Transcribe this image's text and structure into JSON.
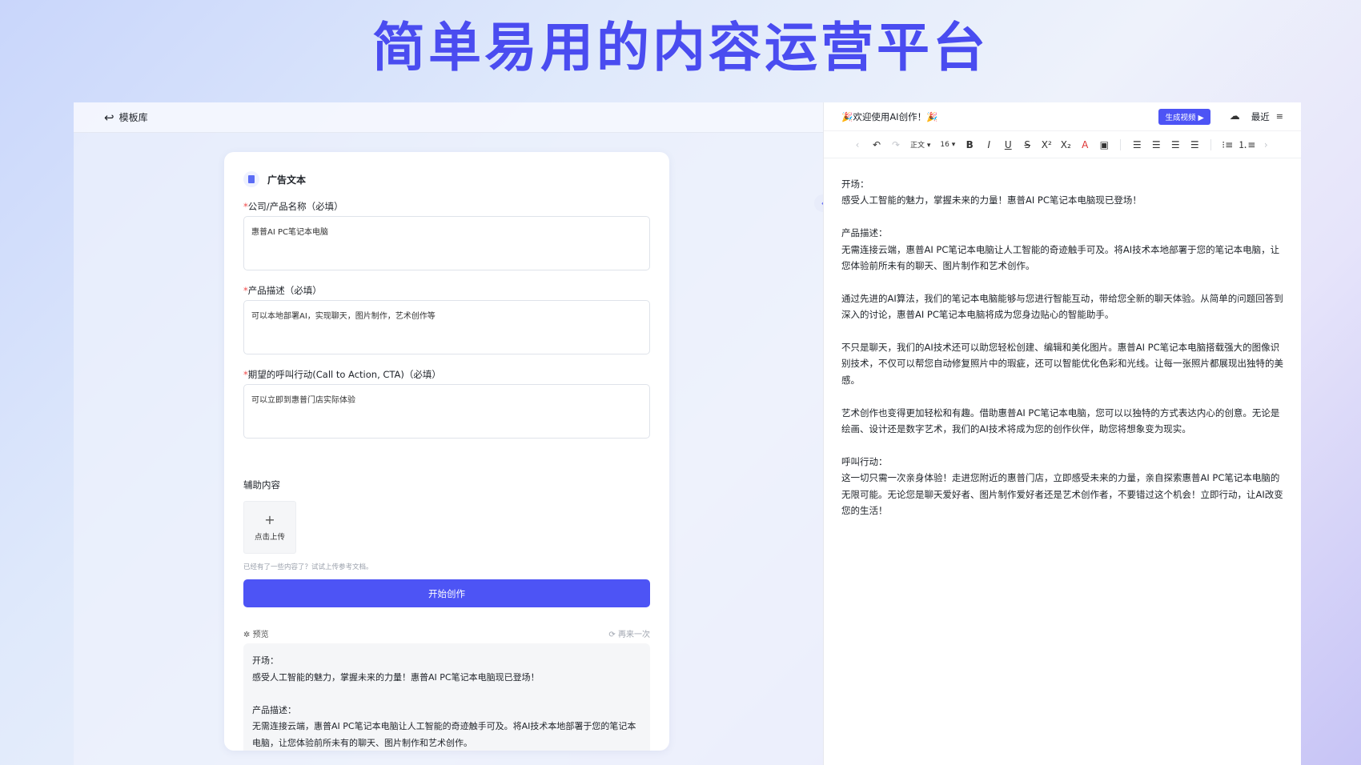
{
  "hero_title": "简单易用的内容运营平台",
  "left": {
    "back_label": "模板库",
    "card_title": "广告文本",
    "fields": [
      {
        "label": "公司/产品名称（必填）",
        "value": "惠普AI PC笔记本电脑"
      },
      {
        "label": "产品描述（必填）",
        "value": "可以本地部署AI，实现聊天，图片制作，艺术创作等"
      },
      {
        "label": "期望的呼叫行动(Call to Action, CTA)（必填）",
        "value": "可以立即到惠普门店实际体验"
      }
    ],
    "aux_label": "辅助内容",
    "upload_label": "点击上传",
    "hint": "已经有了一些内容了？试试上传参考文档。",
    "start_button": "开始创作",
    "preview_label": "预览",
    "again_label": "再来一次",
    "preview_lines": [
      "开场：",
      "感受人工智能的魅力，掌握未来的力量！惠普AI PC笔记本电脑现已登场！",
      "",
      "产品描述：",
      "无需连接云端，惠普AI PC笔记本电脑让人工智能的奇迹触手可及。将AI技术本地部署于您的笔记本电脑，让您体验前所未有的聊天、图片制作和艺术创作。"
    ]
  },
  "right": {
    "welcome": "🎉欢迎使用AI创作！🎉",
    "generate_video": "生成视频 ▶",
    "recent": "最近",
    "toolbar": {
      "style": "正文 ▾",
      "size": "16 ▾"
    },
    "paragraphs": [
      [
        "开场：",
        "感受人工智能的魅力，掌握未来的力量！惠普AI PC笔记本电脑现已登场！"
      ],
      [
        "产品描述：",
        "无需连接云端，惠普AI PC笔记本电脑让人工智能的奇迹触手可及。将AI技术本地部署于您的笔记本电脑，让您体验前所未有的聊天、图片制作和艺术创作。"
      ],
      [
        "通过先进的AI算法，我们的笔记本电脑能够与您进行智能互动，带给您全新的聊天体验。从简单的问题回答到深入的讨论，惠普AI PC笔记本电脑将成为您身边贴心的智能助手。"
      ],
      [
        "不只是聊天，我们的AI技术还可以助您轻松创建、编辑和美化图片。惠普AI PC笔记本电脑搭载强大的图像识别技术，不仅可以帮您自动修复照片中的瑕疵，还可以智能优化色彩和光线。让每一张照片都展现出独特的美感。"
      ],
      [
        "艺术创作也变得更加轻松和有趣。借助惠普AI PC笔记本电脑，您可以以独特的方式表达内心的创意。无论是绘画、设计还是数字艺术，我们的AI技术将成为您的创作伙伴，助您将想象变为现实。"
      ],
      [
        "呼叫行动：",
        "这一切只需一次亲身体验！走进您附近的惠普门店，立即感受未来的力量，亲自探索惠普AI PC笔记本电脑的无限可能。无论您是聊天爱好者、图片制作爱好者还是艺术创作者，不要错过这个机会！立即行动，让AI改变您的生活！"
      ]
    ]
  }
}
